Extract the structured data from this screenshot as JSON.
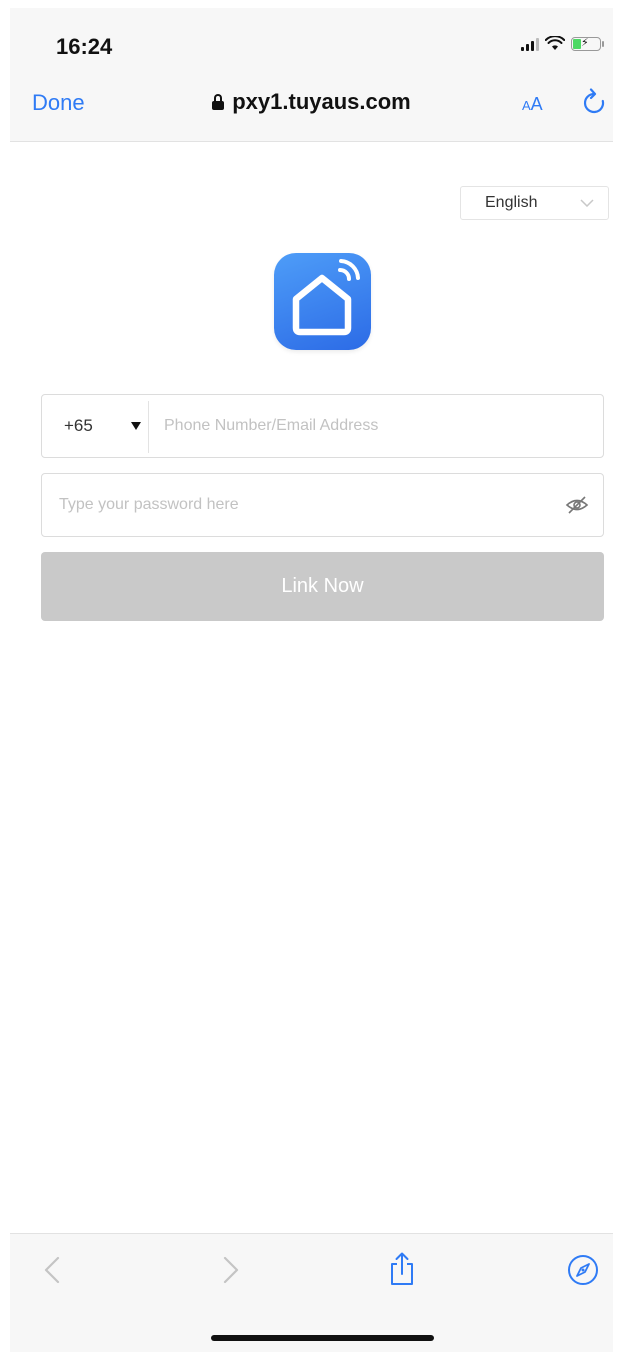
{
  "status_bar": {
    "time": "16:24"
  },
  "browser_nav": {
    "done_label": "Done",
    "url": "pxy1.tuyaus.com",
    "text_size_small": "A",
    "text_size_large": "A"
  },
  "language_select": {
    "value": "English"
  },
  "login_form": {
    "country_code": "+65",
    "account_placeholder": "Phone Number/Email Address",
    "password_placeholder": "Type your password here",
    "submit_label": "Link Now"
  },
  "colors": {
    "accent": "#2f7bf5",
    "logo_gradient_top": "#4e9df8",
    "logo_gradient_bottom": "#2c6be6",
    "button_disabled": "#c9c9c9"
  },
  "icons": {
    "lock": "lock-icon",
    "reload": "reload-icon",
    "dropdown": "chevron-down-icon",
    "logo": "smart-home-logo-icon",
    "password_visibility": "eye-slash-icon",
    "back": "chevron-left-icon",
    "forward": "chevron-right-icon",
    "share": "share-icon",
    "compass": "compass-icon"
  }
}
